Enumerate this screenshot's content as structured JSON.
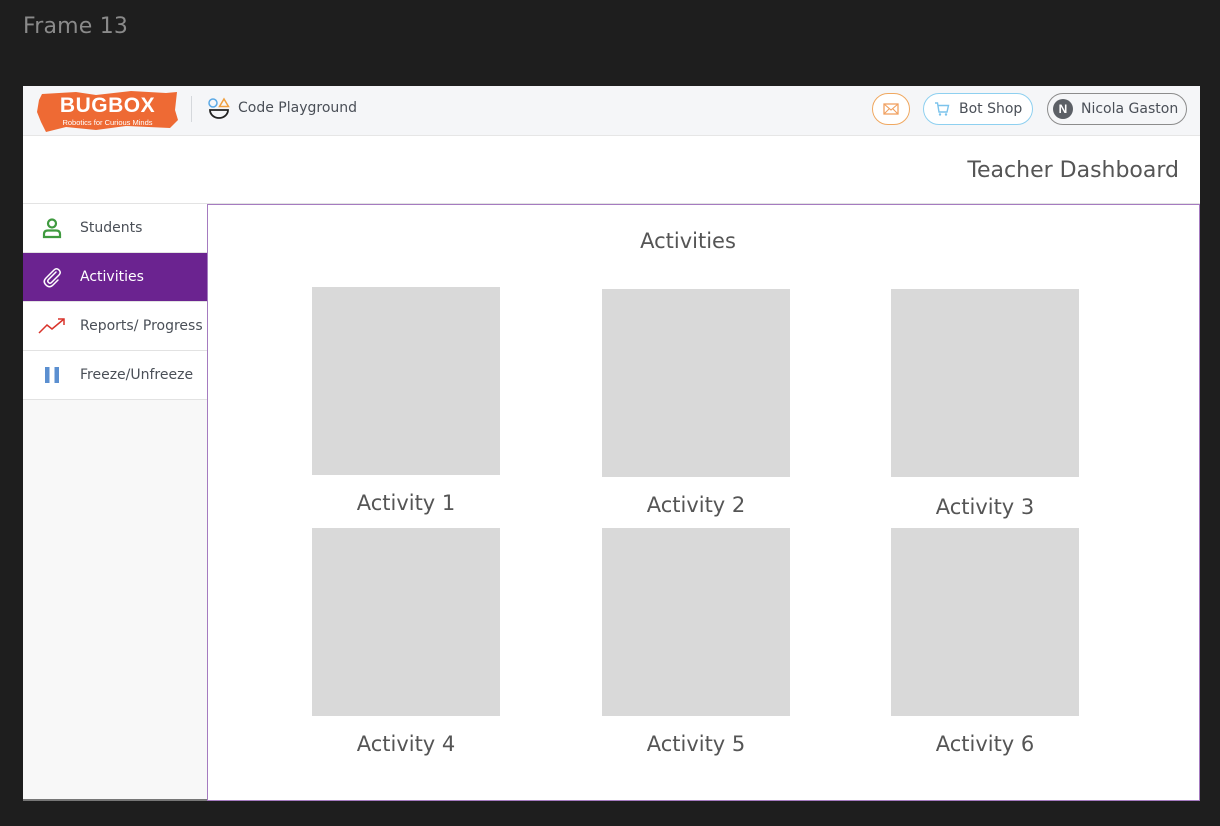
{
  "frame_label": "Frame 13",
  "brand": {
    "name": "BUGBOX",
    "tagline": "Robotics for Curious Minds",
    "color": "#ee6a34"
  },
  "header": {
    "app_link": "Code Playground",
    "app_icon": "code-playground-icon",
    "mail_icon": "mail-icon",
    "shop_label": "Bot Shop",
    "shop_icon": "cart-icon",
    "user_initial": "N",
    "user_name": "Nicola Gaston"
  },
  "page": {
    "title": "Teacher Dashboard",
    "accent": "#6b2390"
  },
  "sidebar": {
    "items": [
      {
        "label": "Students",
        "icon": "person-icon",
        "active": false
      },
      {
        "label": "Activities",
        "icon": "paperclip-icon",
        "active": true
      },
      {
        "label": "Reports/ Progress",
        "icon": "trend-up-icon",
        "active": false
      },
      {
        "label": "Freeze/Unfreeze",
        "icon": "pause-icon",
        "active": false
      }
    ]
  },
  "main": {
    "section_title": "Activities",
    "activities": [
      {
        "label": "Activity 1"
      },
      {
        "label": "Activity 2"
      },
      {
        "label": "Activity 3"
      },
      {
        "label": "Activity 4"
      },
      {
        "label": "Activity 5"
      },
      {
        "label": "Activity 6"
      }
    ]
  }
}
